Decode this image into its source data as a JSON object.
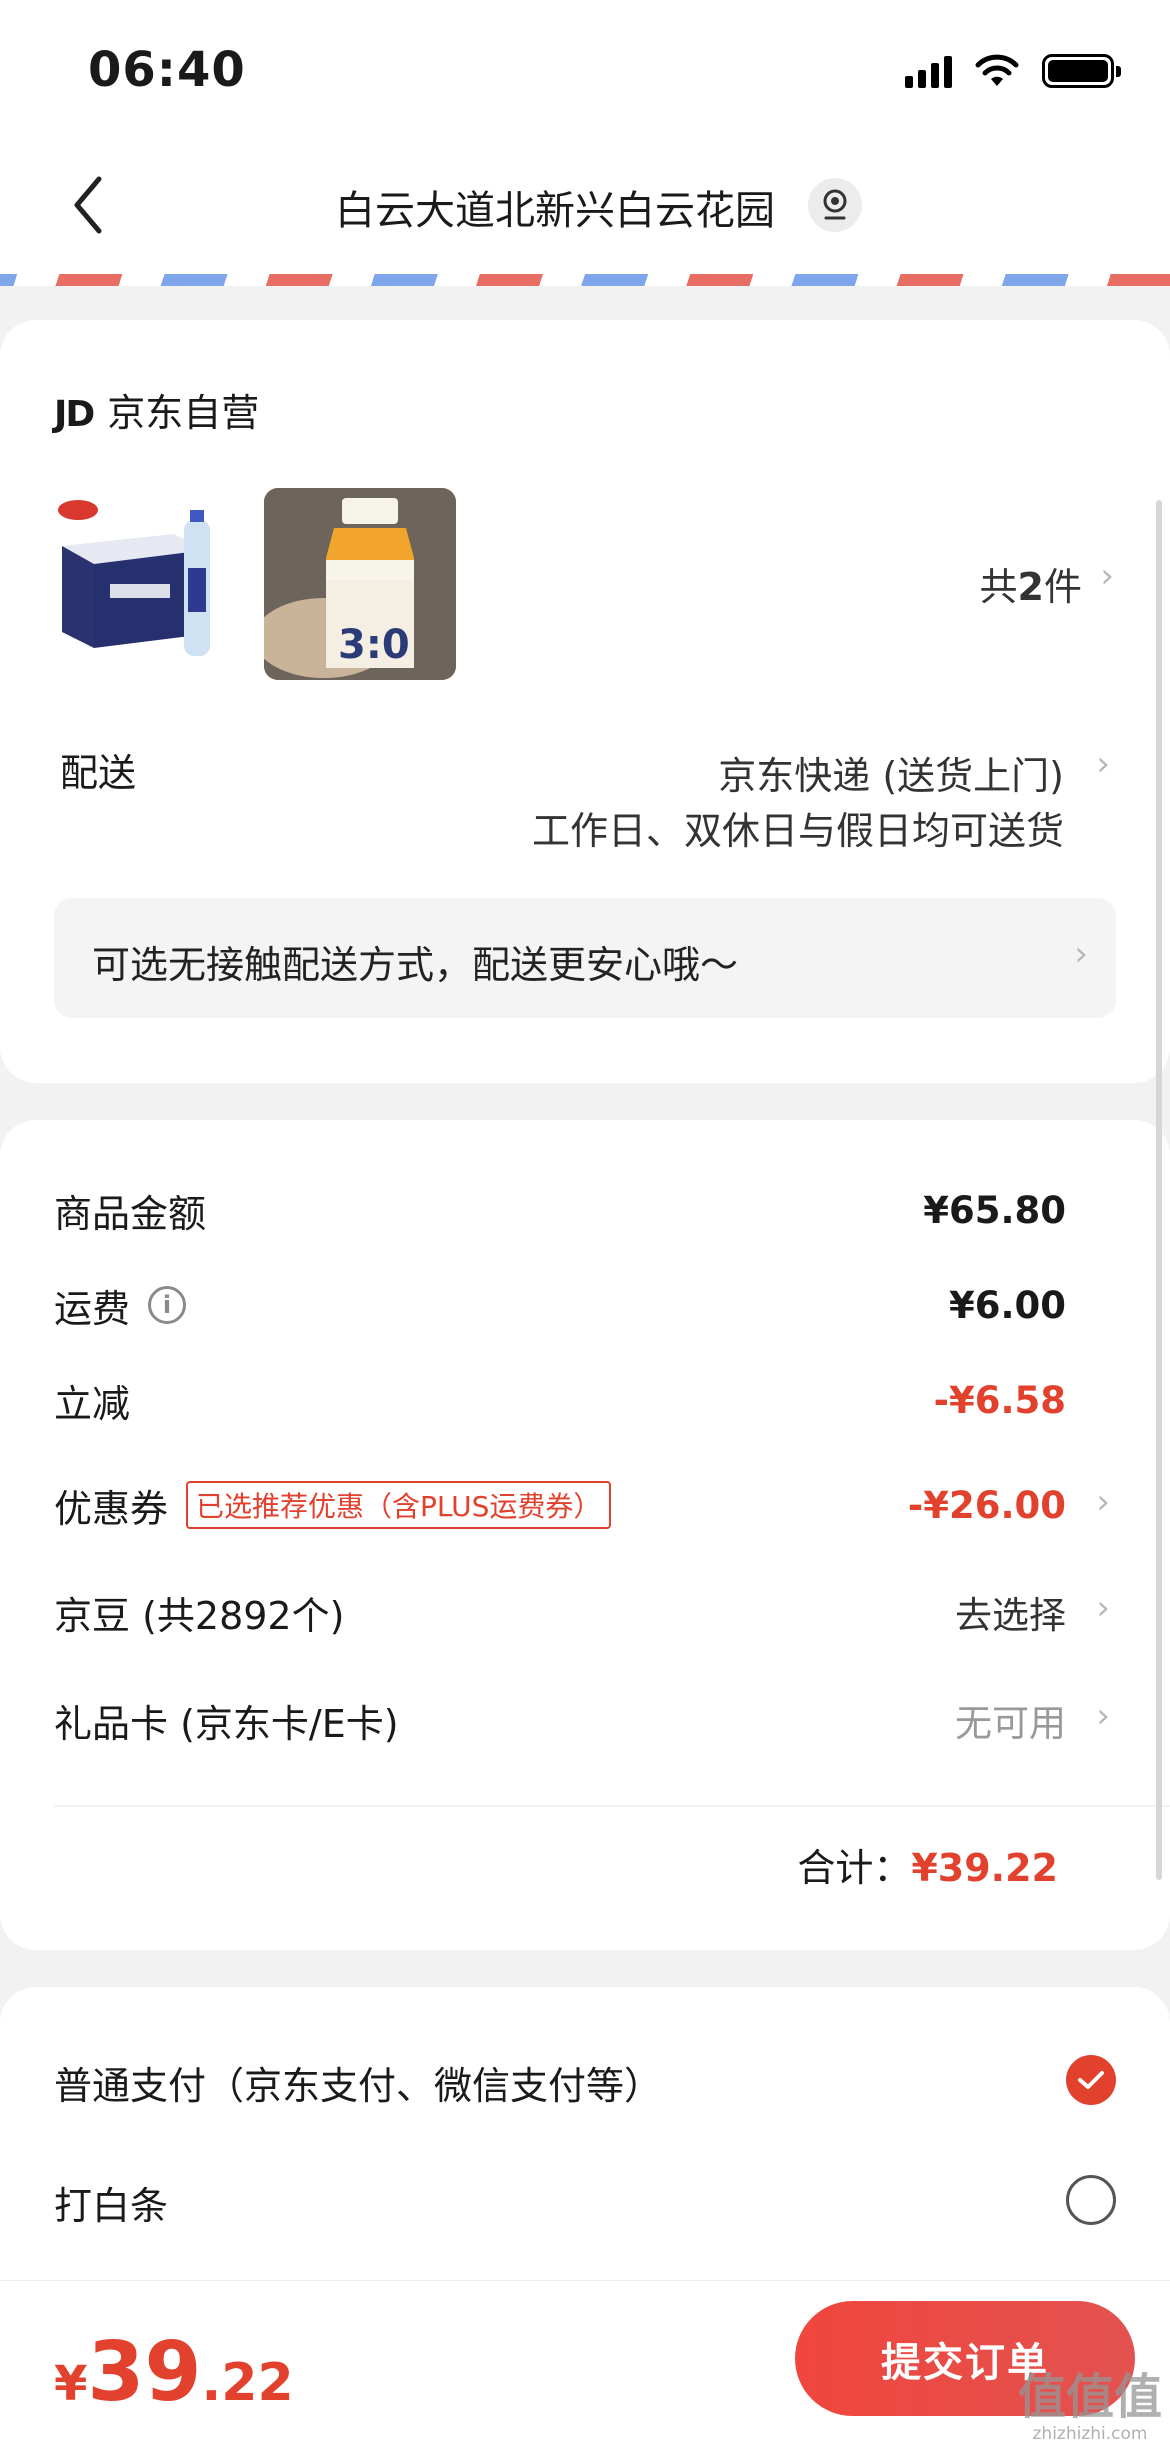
{
  "status": {
    "time": "06:40"
  },
  "header": {
    "title": "白云大道北新兴白云花园"
  },
  "store": {
    "logo_text": "JD",
    "name": "京东自营"
  },
  "items": {
    "count_prefix": "共",
    "count": "2",
    "count_suffix": "件"
  },
  "delivery": {
    "label": "配送",
    "method": "京东快递 (送货上门)",
    "schedule": "工作日、双休日与假日均可送货",
    "contactless_hint": "可选无接触配送方式，配送更安心哦～"
  },
  "summary": {
    "goods_label": "商品金额",
    "goods_value": "¥65.80",
    "shipping_label": "运费",
    "shipping_value": "¥6.00",
    "discount_label": "立减",
    "discount_value": "-¥6.58",
    "coupon_label": "优惠券",
    "coupon_badge": "已选推荐优惠（含PLUS运费券）",
    "coupon_value": "-¥26.00",
    "beans_label": "京豆 (共2892个)",
    "beans_value": "去选择",
    "giftcard_label": "礼品卡 (京东卡/E卡)",
    "giftcard_value": "无可用",
    "total_label": "合计：",
    "total_value": "¥39.22"
  },
  "payment": {
    "options": [
      {
        "label": "普通支付（京东支付、微信支付等）",
        "selected": true
      },
      {
        "label": "打白条",
        "selected": false
      }
    ]
  },
  "footer": {
    "currency": "¥",
    "price_int": "39",
    "price_dec": ".22",
    "submit_label": "提交订单"
  },
  "watermark": {
    "brand": "值值值",
    "site": "zhizhizhi.com"
  },
  "colors": {
    "accent": "#e2412d",
    "background": "#f2f2f2"
  }
}
